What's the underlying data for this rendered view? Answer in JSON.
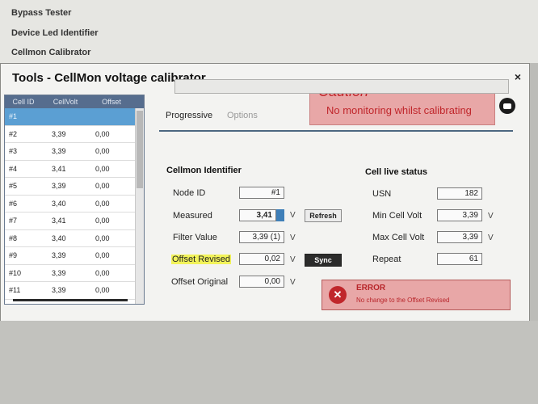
{
  "background_menu": [
    "Bypass Tester",
    "Device Led Identifier",
    "Cellmon Calibrator"
  ],
  "window": {
    "title": "Tools - CellMon voltage calibrator",
    "close_glyph": "×"
  },
  "caution": {
    "title": "Caution",
    "text": "No monitoring whilst calibrating"
  },
  "cell_table": {
    "columns": [
      "Cell ID",
      "CellVolt",
      "Offset"
    ],
    "rows": [
      {
        "id": "#1",
        "volt": "",
        "offset": ""
      },
      {
        "id": "#2",
        "volt": "3,39",
        "offset": "0,00"
      },
      {
        "id": "#3",
        "volt": "3,39",
        "offset": "0,00"
      },
      {
        "id": "#4",
        "volt": "3,41",
        "offset": "0,00"
      },
      {
        "id": "#5",
        "volt": "3,39",
        "offset": "0,00"
      },
      {
        "id": "#6",
        "volt": "3,40",
        "offset": "0,00"
      },
      {
        "id": "#7",
        "volt": "3,41",
        "offset": "0,00"
      },
      {
        "id": "#8",
        "volt": "3,40",
        "offset": "0,00"
      },
      {
        "id": "#9",
        "volt": "3,39",
        "offset": "0,00"
      },
      {
        "id": "#10",
        "volt": "3,39",
        "offset": "0,00"
      },
      {
        "id": "#11",
        "volt": "3,39",
        "offset": "0,00"
      }
    ]
  },
  "tabs": [
    "Progressive",
    "Options"
  ],
  "identifier": {
    "title": "Cellmon Identifier",
    "node_id_label": "Node ID",
    "node_id": "#1",
    "measured_label": "Measured",
    "measured": "3,41",
    "measured_unit": "V",
    "refresh_label": "Refresh",
    "filter_label": "Filter Value",
    "filter": "3,39 (1)",
    "filter_unit": "V",
    "offset_revised_label": "Offset Revised",
    "offset_revised": "0,02",
    "offset_revised_unit": "V",
    "sync_label": "Sync",
    "offset_original_label": "Offset Original",
    "offset_original": "0,00",
    "offset_original_unit": "V"
  },
  "live": {
    "title": "Cell live status",
    "usn_label": "USN",
    "usn": "182",
    "min_label": "Min Cell Volt",
    "min": "3,39",
    "min_unit": "V",
    "max_label": "Max Cell Volt",
    "max": "3,39",
    "max_unit": "V",
    "repeat_label": "Repeat",
    "repeat": "61"
  },
  "error": {
    "title": "ERROR",
    "text": "No change to the Offset Revised",
    "icon_glyph": "✕"
  },
  "colors": {
    "caution_bg": "#e8a7a7",
    "caution_text": "#c0262b",
    "selected_row": "#5b9fd3",
    "highlight": "#f2f35a"
  }
}
